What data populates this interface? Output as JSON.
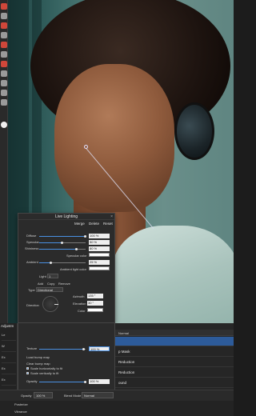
{
  "lighting": {
    "title": "Live Lighting",
    "header": {
      "merge": "Merge",
      "delete": "Delete",
      "reset": "Reset"
    },
    "diffuse": {
      "label": "Diffuse",
      "value": "100 %",
      "level": 1.0
    },
    "specular": {
      "label": "Specular",
      "value": "50 %",
      "level": 0.5
    },
    "shininess": {
      "label": "Shininess",
      "value": "80 %",
      "level": 0.8
    },
    "specular_color_label": "Specular color",
    "ambient": {
      "label": "Ambient",
      "value": "25 %",
      "level": 0.25
    },
    "ambient_color_label": "Ambient light color",
    "light_label": "Light",
    "light_value": "1",
    "add": "Add",
    "copy": "Copy",
    "remove": "Remove",
    "type_label": "Type",
    "type_value": "Directional",
    "direction_label": "Direction",
    "azimuth": {
      "label": "Azimuth",
      "value": "135 °"
    },
    "elevation": {
      "label": "Elevation",
      "value": "30 °"
    },
    "color_label": "Color",
    "texture": {
      "label": "Texture",
      "value": "100 %",
      "level": 0.95
    },
    "load_bump": "Load bump map",
    "clear_bump": "Clear bump map",
    "scale_h": "Scale horizontally to fit",
    "scale_v": "Scale vertically to fit",
    "opacity": {
      "label": "Opacity",
      "value": "100 %",
      "level": 1.0
    }
  },
  "adjustments": {
    "title": "Adjustm",
    "rows": [
      "Le",
      "W",
      "Ex",
      "Ex",
      "Ex"
    ]
  },
  "layers": {
    "blend_mode": "Normal",
    "rows": [
      {
        "label": "",
        "selected": true
      },
      {
        "label": "p Mask",
        "selected": false
      },
      {
        "label": "Reduction",
        "selected": false
      },
      {
        "label": "Reduction",
        "selected": false
      },
      {
        "label": "ound",
        "selected": false
      }
    ]
  },
  "bottom_bar": {
    "opacity_label": "Opacity",
    "opacity_value": "100 %",
    "blend_label": "Blend Mode",
    "blend_value": "Normal"
  },
  "footer": {
    "items": [
      "Posterize",
      "Vibrance"
    ]
  },
  "colors": {
    "accent": "#4a90e2",
    "panel": "#2b2b2b",
    "selection": "#2d5b9a"
  }
}
